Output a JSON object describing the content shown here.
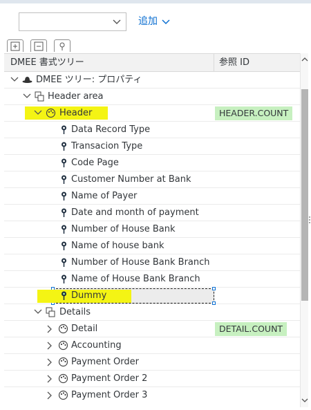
{
  "toolbar": {
    "select_value": "",
    "add_label": "追加"
  },
  "table_header": {
    "col_tree": "DMEE 書式ツリー",
    "col_ref": "参照 ID"
  },
  "tree": {
    "root": "DMEE ツリー: プロパティ",
    "header_area": "Header area",
    "header": "Header",
    "header_ref": "HEADER.COUNT",
    "header_fields": [
      "Data Record Type",
      "Transacion Type",
      "Code Page",
      "Customer Number at Bank",
      "Name of Payer",
      "Date and month of payment",
      "Number of House Bank",
      "Name of house bank",
      "Number of House Bank Branch",
      "Name of House Bank Branch"
    ],
    "dummy": "Dummy",
    "details": "Details",
    "detail": "Detail",
    "detail_ref": "DETAIL.COUNT",
    "detail_siblings": [
      "Accounting",
      "Payment Order",
      "Payment Order 2",
      "Payment Order 3"
    ]
  },
  "colors": {
    "accent": "#0a6ed1",
    "highlight": "#f4f414",
    "ref_bg": "#c7f0c0"
  },
  "icons": {
    "root": "hat-icon",
    "node": "structure-node-icon",
    "segment": "segment-palette-icon",
    "field": "field-pin-icon"
  }
}
